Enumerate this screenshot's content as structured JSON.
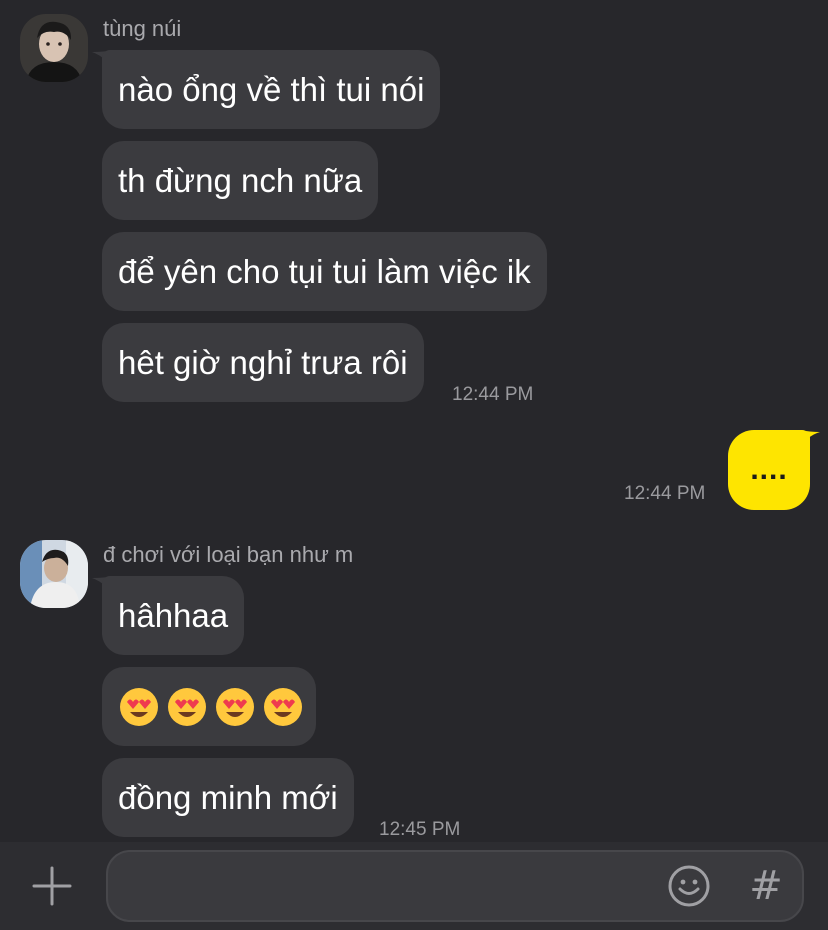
{
  "messages": [
    {
      "sender": "tùng núi",
      "lines": [
        "nào ổng về thì tui nói",
        "th đừng nch nữa",
        "để yên cho tụi tui làm việc ik",
        "hêt giờ nghỉ trưa rôi"
      ],
      "time": "12:44 PM"
    },
    {
      "mine": true,
      "text": "....",
      "time": "12:44 PM"
    },
    {
      "sender": "đ chơi với loại bạn như m",
      "lines": [
        "hâhhaa",
        "đồng minh mới"
      ],
      "emoji_count": 4,
      "emoji_name": "smiling-face-with-heart-eyes",
      "time": "12:45 PM"
    }
  ],
  "input": {
    "placeholder": ""
  },
  "icons": {
    "attach": "plus-icon",
    "emoji": "smiley-icon",
    "hashtag": "hash-icon"
  },
  "colors": {
    "background": "#27272b",
    "bubble_theirs": "#3b3b3f",
    "bubble_mine": "#fee500"
  }
}
